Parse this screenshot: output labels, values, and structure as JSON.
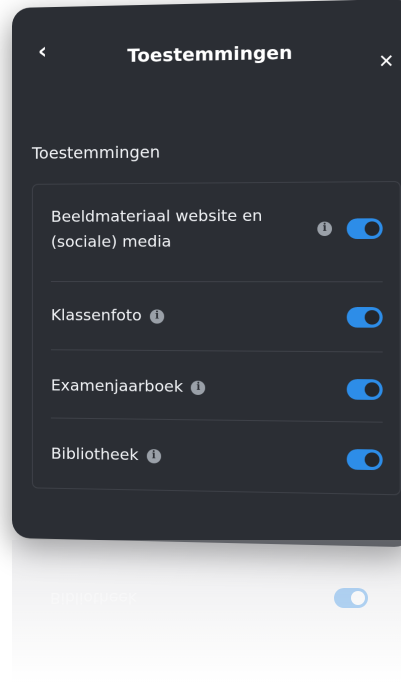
{
  "header": {
    "back_icon": "chevron-left-icon",
    "title": "Toestemmingen",
    "close_icon": "close-icon"
  },
  "section": {
    "title": "Toestemmingen"
  },
  "permissions": [
    {
      "label_line1": "Beeldmateriaal website en",
      "label_line2": "(sociale) media",
      "info_icon": "info-icon",
      "enabled": true
    },
    {
      "label_line1": "Klassenfoto",
      "info_icon": "info-icon",
      "enabled": true
    },
    {
      "label_line1": "Examenjaarboek",
      "info_icon": "info-icon",
      "enabled": true
    },
    {
      "label_line1": "Bibliotheek",
      "info_icon": "info-icon",
      "enabled": true
    }
  ],
  "colors": {
    "panel_background": "#2b2e34",
    "toggle_on": "#2d8de8",
    "text": "#f1f3f6",
    "info_icon": "#9aa0a8"
  }
}
